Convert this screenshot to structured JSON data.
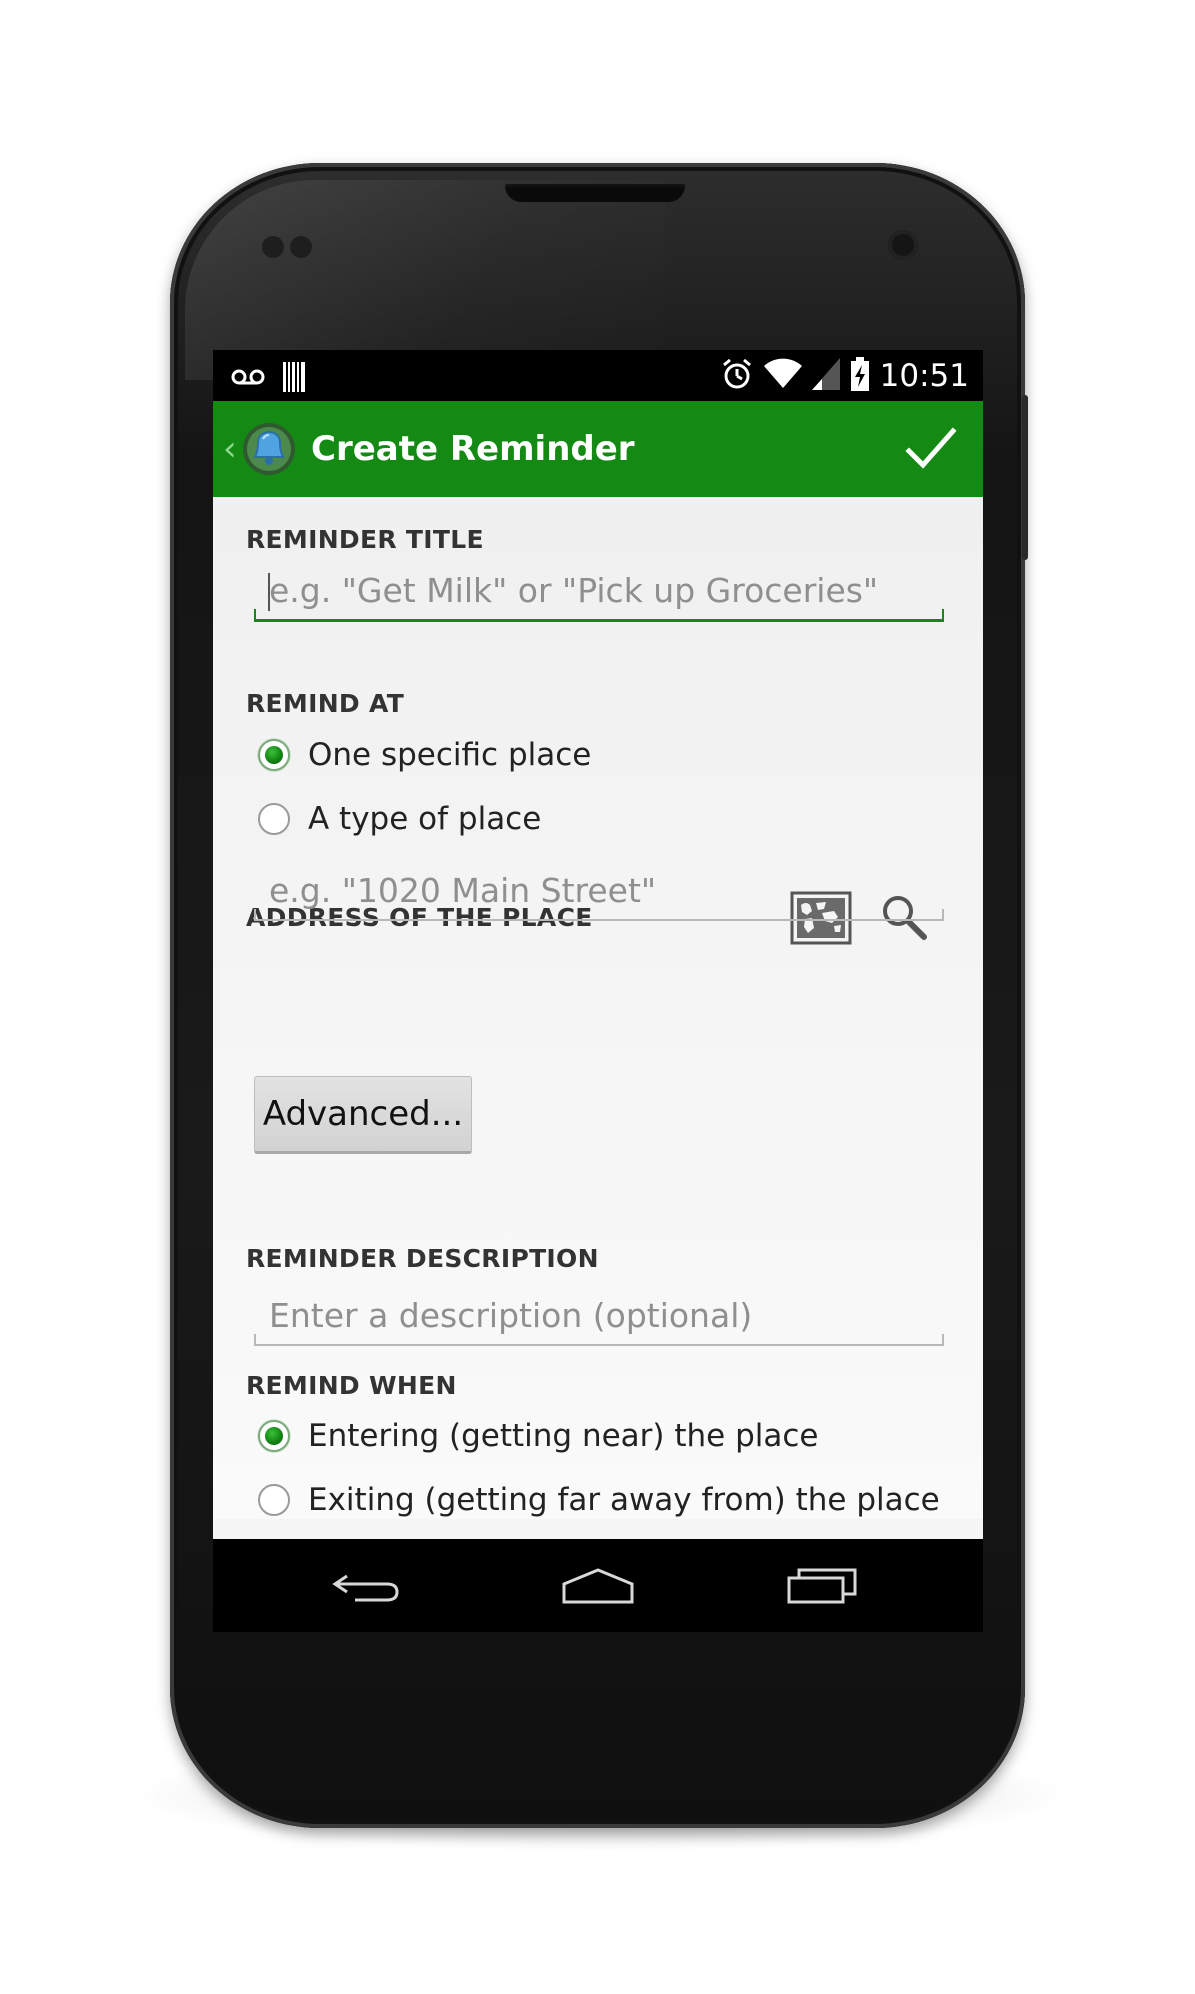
{
  "status_bar": {
    "time": "10:51",
    "icons": [
      "voicemail-icon",
      "barcode-icon",
      "alarm-icon",
      "wifi-icon",
      "signal-icon",
      "battery-charging-icon"
    ]
  },
  "action_bar": {
    "title": "Create Reminder",
    "up_icon": "chevron-left-icon",
    "app_icon": "bell-icon",
    "done_icon": "checkmark-icon"
  },
  "form": {
    "reminder_title": {
      "label": "REMINDER TITLE",
      "placeholder": "e.g. \"Get Milk\" or \"Pick up Groceries\""
    },
    "remind_at": {
      "label": "REMIND AT",
      "options": [
        "One specific place",
        "A type of place"
      ],
      "selected": "One specific place"
    },
    "address": {
      "label": "ADDRESS OF THE PLACE",
      "placeholder": "e.g. \"1020 Main Street\"",
      "map_icon": "map-icon",
      "search_icon": "search-icon"
    },
    "advanced_button": "Advanced...",
    "description": {
      "label": "REMINDER DESCRIPTION",
      "placeholder": "Enter a description (optional)"
    },
    "remind_when": {
      "label": "REMIND WHEN",
      "options": [
        "Entering (getting near) the place",
        "Exiting (getting far away from) the place"
      ],
      "selected": "Entering (getting near) the place"
    }
  },
  "nav_bar": {
    "icons": [
      "back-icon",
      "home-icon",
      "recents-icon"
    ]
  },
  "colors": {
    "accent": "#148a14",
    "action_bar": "#148a14",
    "radio_selected": "#118011",
    "background": "#f5f5f5"
  }
}
